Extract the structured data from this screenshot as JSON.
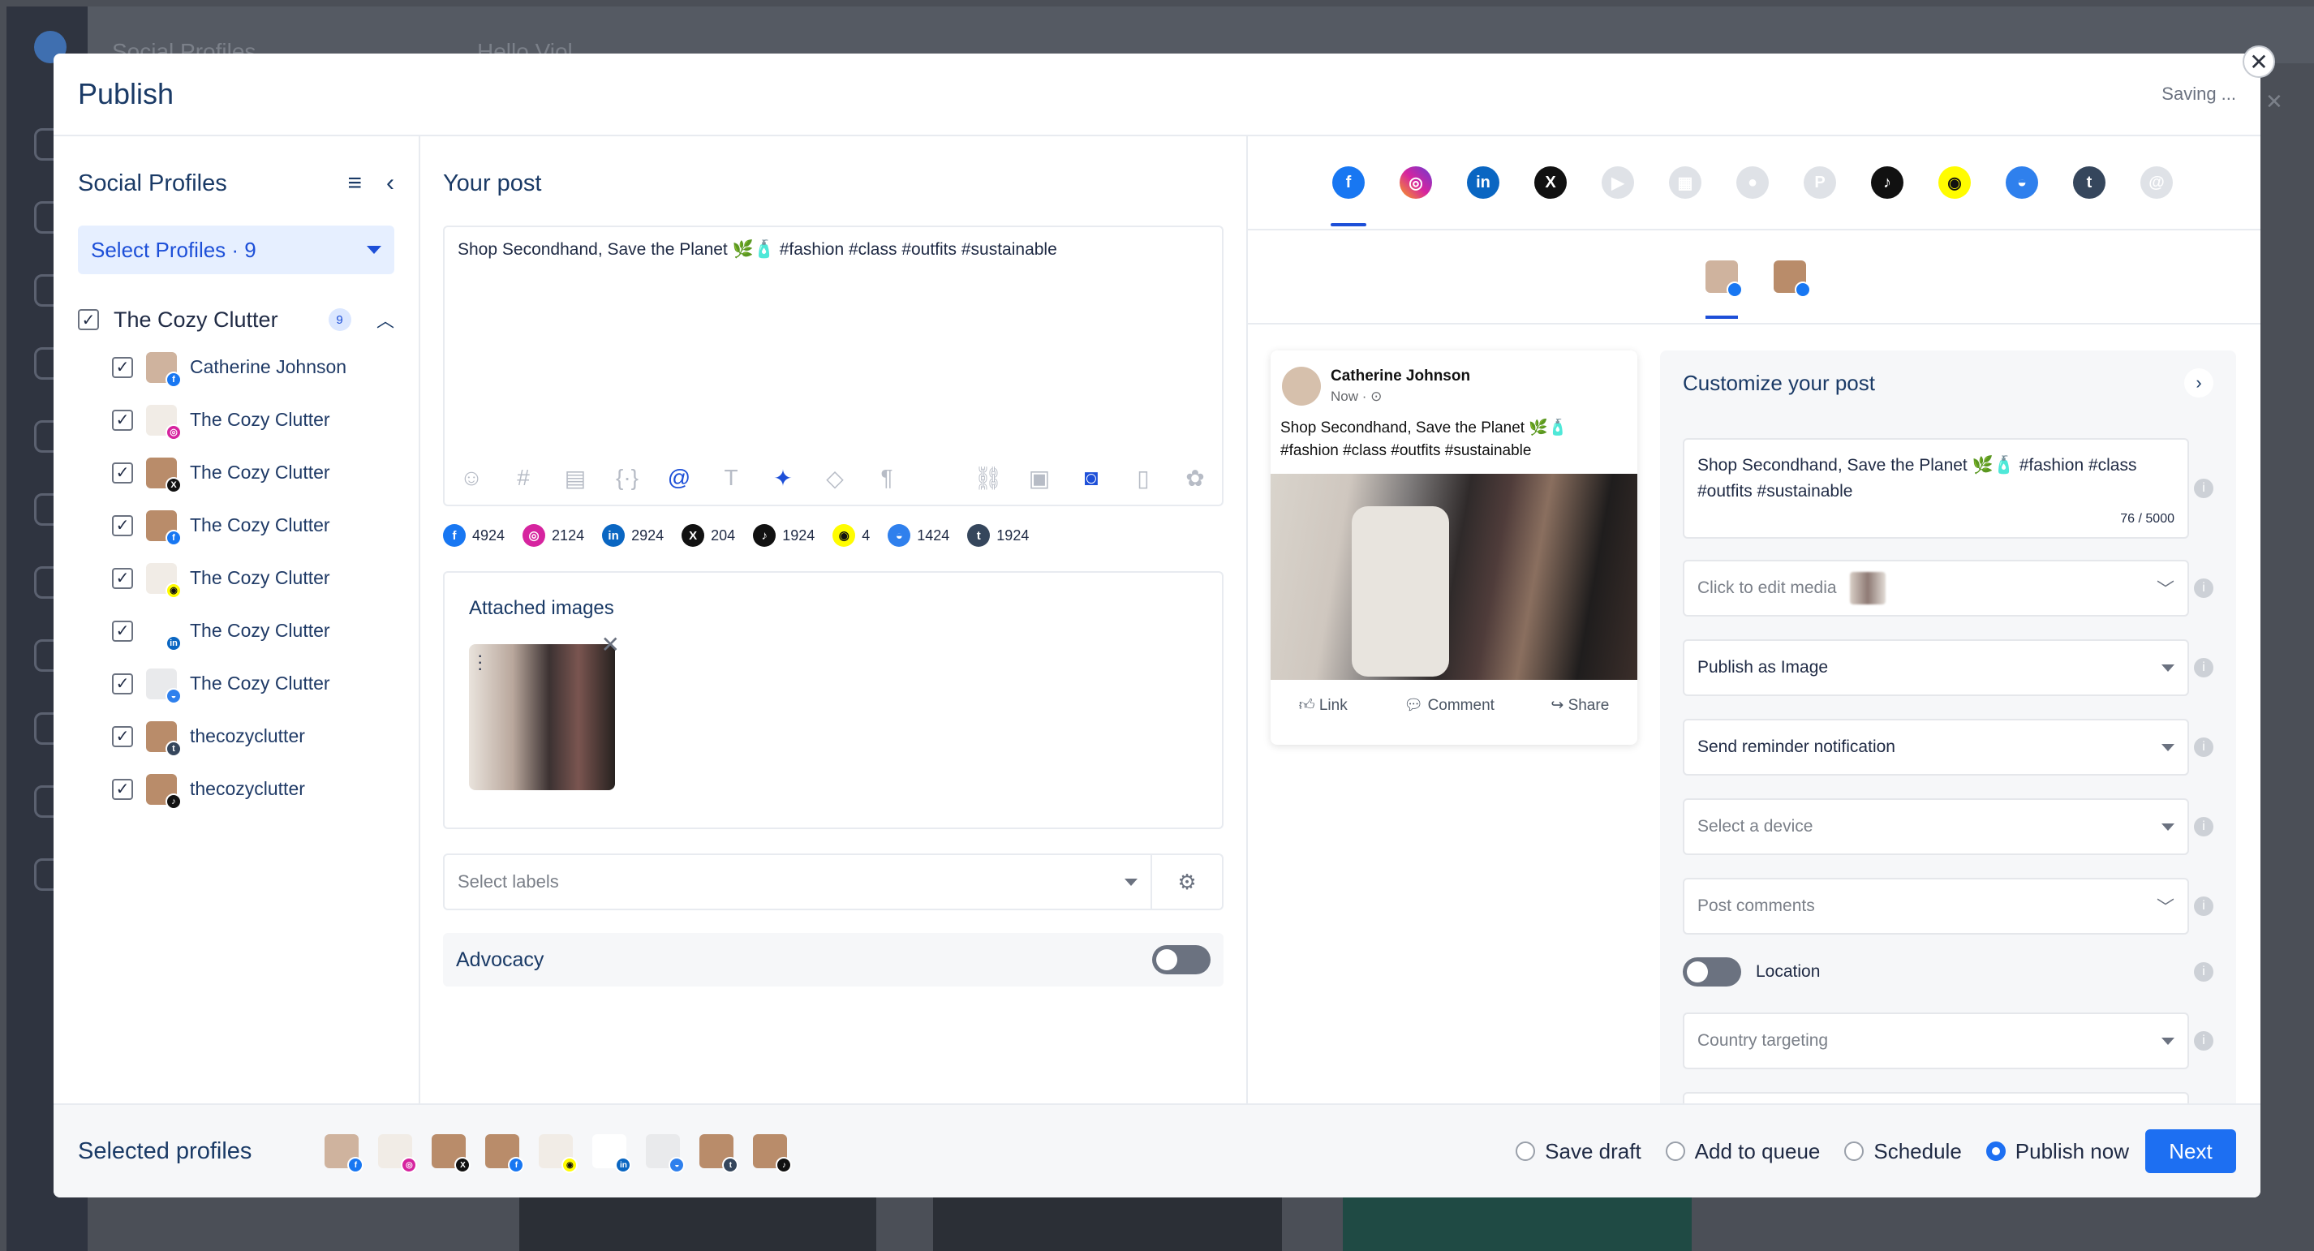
{
  "background": {
    "title_left": "Social Profiles",
    "title_mid": "Hello Viol"
  },
  "modal": {
    "title": "Publish",
    "status": "Saving ...",
    "close_glyph": "✕"
  },
  "left": {
    "title": "Social Profiles",
    "select_label": "Select Profiles · 9",
    "group": {
      "name": "The Cozy Clutter",
      "count": "9"
    },
    "profiles": [
      {
        "name": "Catherine Johnson",
        "network": "facebook",
        "color": "#1877f2",
        "glyph": "f",
        "avatar": "#cfb39e"
      },
      {
        "name": "The Cozy Clutter",
        "network": "instagram",
        "color": "#d6249f",
        "glyph": "◎",
        "avatar": "#f1ece6"
      },
      {
        "name": "The Cozy Clutter",
        "network": "x",
        "color": "#111111",
        "glyph": "X",
        "avatar": "#b98c6a"
      },
      {
        "name": "The Cozy Clutter",
        "network": "facebook",
        "color": "#1877f2",
        "glyph": "f",
        "avatar": "#b98c6a"
      },
      {
        "name": "The Cozy Clutter",
        "network": "snapchat",
        "color": "#fffc00",
        "glyph": "◉",
        "avatar": "#f1ece6"
      },
      {
        "name": "The Cozy Clutter",
        "network": "linkedin",
        "color": "#0a66c2",
        "glyph": "in",
        "avatar": "#ffffff"
      },
      {
        "name": "The Cozy Clutter",
        "network": "gmb",
        "color": "#2f80ed",
        "glyph": "◒",
        "avatar": "#e9eaec"
      },
      {
        "name": "thecozyclutter",
        "network": "tumblr",
        "color": "#35465c",
        "glyph": "t",
        "avatar": "#b98c6a"
      },
      {
        "name": "thecozyclutter",
        "network": "tiktok",
        "color": "#111111",
        "glyph": "♪",
        "avatar": "#b98c6a"
      }
    ]
  },
  "middle": {
    "title": "Your post",
    "post_text": "Shop Secondhand, Save the Planet 🌿🧴 #fashion #class #outfits #sustainable",
    "counts": [
      {
        "network": "facebook",
        "glyph": "f",
        "color": "#1877f2",
        "value": "4924"
      },
      {
        "network": "instagram",
        "glyph": "◎",
        "color": "#d6249f",
        "value": "2124"
      },
      {
        "network": "linkedin",
        "glyph": "in",
        "color": "#0a66c2",
        "value": "2924"
      },
      {
        "network": "x",
        "glyph": "X",
        "color": "#111111",
        "value": "204"
      },
      {
        "network": "tiktok",
        "glyph": "♪",
        "color": "#111111",
        "value": "1924"
      },
      {
        "network": "snapchat",
        "glyph": "◉",
        "color": "#fffc00",
        "value": "4"
      },
      {
        "network": "gmb",
        "glyph": "◒",
        "color": "#2f80ed",
        "value": "1424"
      },
      {
        "network": "tumblr",
        "glyph": "t",
        "color": "#35465c",
        "value": "1924"
      }
    ],
    "attached_title": "Attached images",
    "labels_placeholder": "Select labels",
    "advocacy_label": "Advocacy"
  },
  "right": {
    "network_tabs": [
      {
        "name": "facebook",
        "glyph": "f",
        "color": "#1877f2",
        "state": "active"
      },
      {
        "name": "instagram",
        "glyph": "◎",
        "color": "#d6249f",
        "state": "on"
      },
      {
        "name": "linkedin",
        "glyph": "in",
        "color": "#0a66c2",
        "state": "on"
      },
      {
        "name": "x",
        "glyph": "X",
        "color": "#111111",
        "state": "on"
      },
      {
        "name": "youtube",
        "glyph": "▶",
        "color": "#dfe2e7",
        "state": "off"
      },
      {
        "name": "google-business",
        "glyph": "▦",
        "color": "#dfe2e7",
        "state": "off"
      },
      {
        "name": "reddit",
        "glyph": "●",
        "color": "#dfe2e7",
        "state": "off"
      },
      {
        "name": "pinterest",
        "glyph": "P",
        "color": "#dfe2e7",
        "state": "off"
      },
      {
        "name": "tiktok",
        "glyph": "♪",
        "color": "#111111",
        "state": "on"
      },
      {
        "name": "snapchat",
        "glyph": "◉",
        "color": "#fffc00",
        "state": "on"
      },
      {
        "name": "gmb",
        "glyph": "◒",
        "color": "#2f80ed",
        "state": "on"
      },
      {
        "name": "tumblr",
        "glyph": "t",
        "color": "#35465c",
        "state": "on"
      },
      {
        "name": "threads",
        "glyph": "@",
        "color": "#dfe2e7",
        "state": "off"
      }
    ],
    "preview": {
      "name": "Catherine Johnson",
      "time": "Now · ⊙",
      "text": "Shop Secondhand, Save the Planet 🌿🧴 #fashion #class #outfits #sustainable",
      "action_like": "Link",
      "action_comment": "Comment",
      "action_share": "Share"
    },
    "customize": {
      "title": "Customize your post",
      "text": "Shop Secondhand, Save the Planet 🌿🧴 #fashion #class #outfits #sustainable",
      "counter": "76 / 5000",
      "media": "Click to edit media",
      "publish_as": "Publish as Image",
      "reminder": "Send reminder notification",
      "device": "Select a device",
      "comments": "Post comments",
      "location": "Location",
      "country": "Country targeting"
    }
  },
  "footer": {
    "title": "Selected profiles",
    "avatars": [
      {
        "color": "#cfb39e",
        "net": "#1877f2",
        "glyph": "f"
      },
      {
        "color": "#f1ece6",
        "net": "#d6249f",
        "glyph": "◎"
      },
      {
        "color": "#b98c6a",
        "net": "#111111",
        "glyph": "X"
      },
      {
        "color": "#b98c6a",
        "net": "#1877f2",
        "glyph": "f"
      },
      {
        "color": "#f1ece6",
        "net": "#fffc00",
        "glyph": "◉"
      },
      {
        "color": "#ffffff",
        "net": "#0a66c2",
        "glyph": "in"
      },
      {
        "color": "#e9eaec",
        "net": "#2f80ed",
        "glyph": "◒"
      },
      {
        "color": "#b98c6a",
        "net": "#35465c",
        "glyph": "t"
      },
      {
        "color": "#b98c6a",
        "net": "#111111",
        "glyph": "♪"
      }
    ],
    "options": [
      "Save draft",
      "Add to queue",
      "Schedule",
      "Publish now"
    ],
    "selected_option": "Publish now",
    "next_label": "Next"
  }
}
